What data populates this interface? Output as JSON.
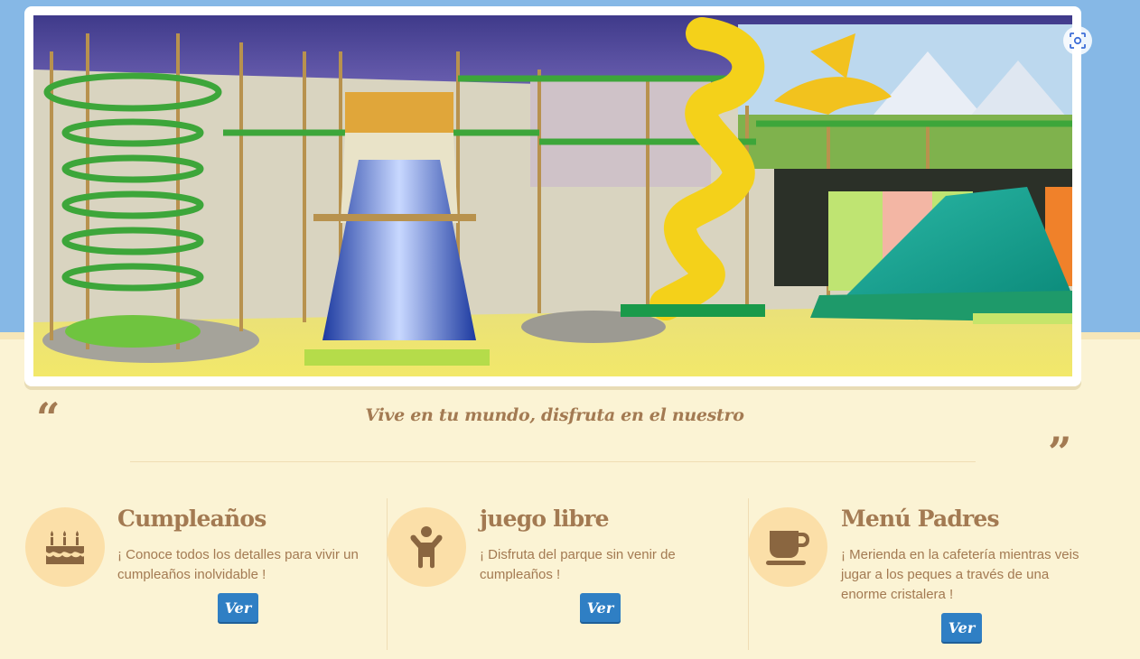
{
  "hero": {
    "screenshot_icon": "screenshot-scan-icon"
  },
  "tagline": {
    "text": "Vive en tu mundo, disfruta en el nuestro",
    "open_quote": "“",
    "close_quote": "”"
  },
  "features": [
    {
      "title": "Cumpleaños",
      "icon": "birthday-cake-icon",
      "description": "¡ Conoce todos los detalles para vivir un cumpleaños inolvidable !",
      "button_label": "Ver"
    },
    {
      "title": "juego libre",
      "icon": "child-icon",
      "description": "¡ Disfruta del parque sin venir de cumpleaños !",
      "button_label": "Ver"
    },
    {
      "title": "Menú Padres",
      "icon": "coffee-cup-icon",
      "description": "¡ Merienda en la cafetería mientras veis jugar a los peques a través de una enorme cristalera !",
      "button_label": "Ver"
    }
  ],
  "colors": {
    "top_band": "#86b8e6",
    "page_background": "#fbf3d4",
    "brand_brown": "#a37a52",
    "icon_circle": "#fbdfa8",
    "button_blue": "#2f7fc4"
  }
}
